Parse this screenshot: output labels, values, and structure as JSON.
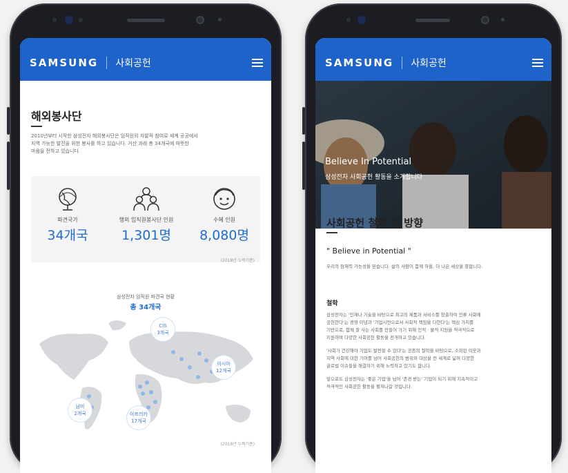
{
  "left": {
    "logo": "SAMSUNG",
    "app_title": "사회공헌",
    "section_title": "해외봉사단",
    "intro": [
      "2010년부터 시작한 삼성전자 해외봉사단은 임직원의 자발적 참여로 세계 공공에서",
      "지역 가능한 발전을 위한 봉사를 하고 있습니다. 거산 과래 총 34개국에 따뜻한",
      "마음을 전하고 있습니다."
    ],
    "stats": [
      {
        "label": "파견국가",
        "value": "34개국"
      },
      {
        "label": "행외 임직원봉사단 인원",
        "value": "1,301명"
      },
      {
        "label": "수혜 인원",
        "value": "8,080명"
      }
    ],
    "stats_note": "(2018년 누적기준)",
    "map_caption": "삼성전자 임직원 파견국 현황",
    "map_total": "총 34개국",
    "regions": [
      {
        "name": "CIS",
        "count": "3개국"
      },
      {
        "name": "아시아",
        "count": "12개국"
      },
      {
        "name": "남미",
        "count": "2개국"
      },
      {
        "name": "아프리카",
        "count": "17개국"
      }
    ],
    "map_note": "(2018년 누적기준)"
  },
  "right": {
    "logo": "SAMSUNG",
    "app_title": "사회공헌",
    "hero_title": "Believe In Potential",
    "hero_sub": "삼성전자 사회공헌 활동을 소개합니다",
    "section_title": "사회공헌 철학 및 방향",
    "quote": "\" Believe in Potential \"",
    "quote_desc": "우리의 잠재력 가능성을 믿습니다. 삶의 사람이 함께 하을, 더 나은 세상을 향합니다.",
    "sub_title": "철학",
    "paragraphs": [
      [
        "삼성전자는 '인재나 기술을 바탕으로 최고의 제품과 서비스를 창출하여 인류 사회에",
        "공헌한다'는 경영 이념과 '기업시민으로서 사회적 책임을 다한다'는 핵심 가치를",
        "기반으로, 함께 잘 사는 사회를 만들어 가기 위해 인적 · 물적 지원을 적극적으로",
        "지원하며 다양한 사회공헌 활동을 전개하고 있습니다."
      ],
      [
        "'사회가 건강해야 기업도 발전할 수 있다'는 공존의 철학을 바탕으로, 소외된 이웃과",
        "지역 사회에 대한 기여를 넘어 사회공헌의 범위와 대상을 전 세계로 넓혀 다양한",
        "글로벌 이슈들을 해결하기 위해 노력하고 있기도 합니다."
      ],
      [
        "앞으로도 삼성전자는 '좋은 기업'을 넘어 '존경 받는' 기업이 되기 위해 지속적이고",
        "적극적인 사회공헌 활동을 펼쳐나갈 것입니다."
      ]
    ]
  },
  "colors": {
    "brand_blue": "#1e63c9",
    "accent_blue": "#1f6cd0",
    "map_gray": "#d6d8db",
    "map_dot": "#8fb8e8"
  }
}
